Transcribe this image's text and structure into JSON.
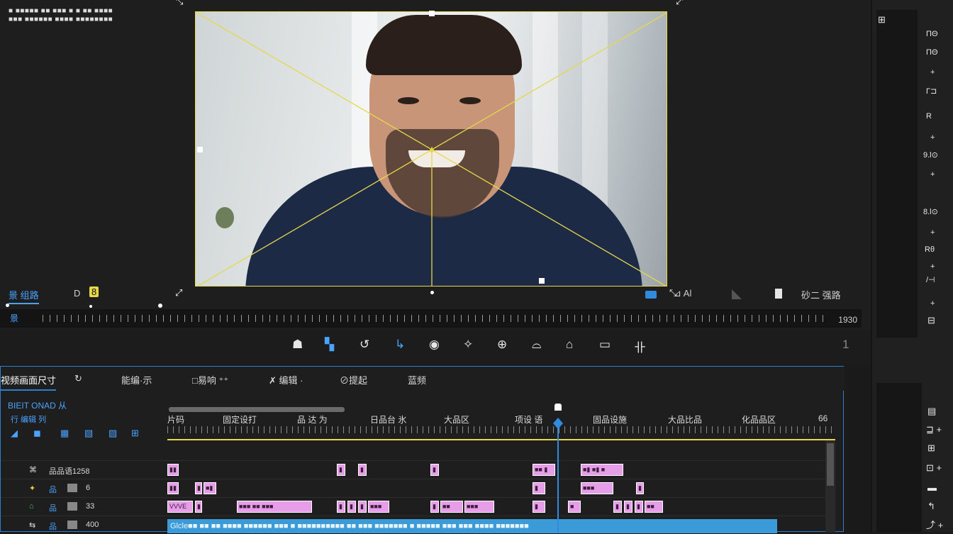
{
  "overlay_top_left": [
    "■ ■■■■■ ■■ ■■■ ■ ■ ■■ ■■■■",
    "■■■ ■■■■■■ ■■■■ ■■■■■■■■",
    "■■■■■■ ■■■■ ■■■■ ■■■■■■■"
  ],
  "preview": {
    "left_label": "景 组路",
    "mode_icons": [
      "D",
      "8"
    ],
    "right_labels": [
      "⊿ Al",
      "砂二 强路"
    ],
    "ruler_label": "景",
    "ruler_end": "1930"
  },
  "toolbar": {
    "tools": [
      "select-tool-icon",
      "crop-tool-icon",
      "rotate-tool-icon",
      "hook-tool-icon",
      "target-tool-icon",
      "magic-tool-icon",
      "globe-tool-icon",
      "bowl-tool-icon",
      "home-tool-icon",
      "monitor-tool-icon",
      "split-tool-icon"
    ],
    "glyphs": [
      "☗",
      "▚",
      "↺",
      "↳",
      "◉",
      "✧",
      "⊕",
      "⌓",
      "⌂",
      "▭",
      "卝"
    ],
    "right_number": "1"
  },
  "right_panel": {
    "top_icon": "⊞",
    "items": [
      "ΠΘ",
      "ΠΘ",
      "+",
      "Γ⊐",
      "R",
      "+",
      "9.l⊙",
      "+",
      "8.l⊙",
      "+",
      "Rθ",
      "+",
      "/⊣",
      "+",
      "⊟"
    ],
    "lower_items": [
      "▤",
      "⊒ +",
      "⊞",
      "⊡ +",
      "▬",
      "↰",
      "⤴ +"
    ]
  },
  "timeline": {
    "tabs": [
      "视频画面尺寸",
      "↻",
      "能编·示",
      "□易响 ⁺⁺",
      "✗ 编辑 ·",
      "⊘提起",
      "蓝频"
    ],
    "track_header_title": "BIEIT ONAD 从",
    "header_icons": [
      "◢",
      "◼",
      "▦",
      "▧",
      "▨",
      "⊞"
    ],
    "header_labels": [
      "行 编辑 列"
    ],
    "ruler_labels": [
      "片码",
      "固定设打",
      "品 达 为",
      "日品台 氷",
      "大品区",
      "项设 语",
      "固品设施",
      "大品比品",
      "化品品区",
      "66"
    ],
    "tracks": [
      {
        "icon": "⌘",
        "name": "品品语1258"
      },
      {
        "icon": "✦",
        "name": "品",
        "value": "6"
      },
      {
        "icon": "⌂",
        "name": "品",
        "value": "33"
      },
      {
        "icon": "⇆",
        "name": "品",
        "value": "400"
      }
    ],
    "clips_row1": [
      "▮▮",
      "▮",
      "▮",
      "▮",
      "■■ ▮",
      "■▮ ■▮ ■"
    ],
    "clips_row2": [
      "▮▮",
      "▮",
      "■▮",
      "▮",
      "▮",
      "■■■",
      "▮"
    ],
    "clips_row3": [
      "VVVE",
      "▮",
      "■■■ ■■ ■■■",
      "▮",
      "▮",
      "▮",
      "■■■",
      "▮",
      "■■",
      "■■■",
      "▮",
      "■",
      "▮",
      "▮",
      "▮",
      "■■"
    ],
    "audio_clip": "Glcle■■ ■■ ■■ ■■■■  ■■■■■■ ■■■  ■ ■■■■■■■■■■ ■■ ■■■ ■■■■■■■  ■ ■■■■■ ■■■ ■■■ ■■■■ ■■■■■■■"
  },
  "colors": {
    "accent_blue": "#2f7fd0",
    "guide_yellow": "#e6d84a",
    "clip_pink": "#e79ee8",
    "clip_blue": "#3b9bd8"
  }
}
